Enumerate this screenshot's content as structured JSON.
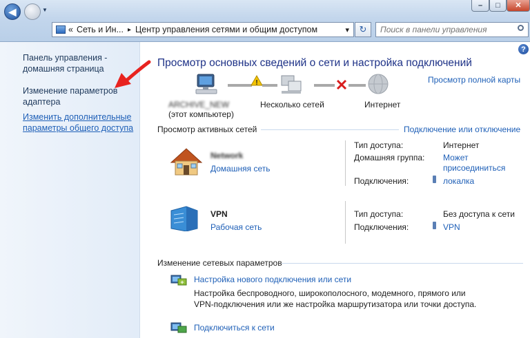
{
  "window": {
    "minimize_glyph": "–",
    "maximize_glyph": "□",
    "close_glyph": "✕"
  },
  "address": {
    "prefix": "«",
    "segment1": "Сеть и Ин...",
    "separator": "▸",
    "segment2": "Центр управления сетями и общим доступом",
    "dropdown": "▾",
    "refresh_glyph": "↻"
  },
  "search": {
    "placeholder": "Поиск в панели управления"
  },
  "sidebar": {
    "items": [
      {
        "label": "Панель управления - домашняя страница"
      },
      {
        "label": "Изменение параметров адаптера"
      },
      {
        "label": "Изменить дополнительные параметры общего доступа"
      }
    ]
  },
  "main": {
    "title": "Просмотр основных сведений о сети и настройка подключений",
    "view_full_map": "Просмотр полной карты",
    "map": {
      "computer_name": "ARCHIVE_NEW",
      "computer_sub": "(этот компьютер)",
      "multiple_networks": "Несколько сетей",
      "internet": "Интернет"
    },
    "active_networks_title": "Просмотр активных сетей",
    "connect_disconnect": "Подключение или отключение",
    "networks": [
      {
        "name": "Network",
        "type": "Домашняя сеть",
        "access_label": "Тип доступа:",
        "access_value": "Интернет",
        "homegroup_label": "Домашняя группа:",
        "homegroup_value": "Может присоединиться",
        "connections_label": "Подключения:",
        "connections_value": "локалка"
      },
      {
        "name": "VPN",
        "type": "Рабочая сеть",
        "access_label": "Тип доступа:",
        "access_value": "Без доступа к сети",
        "connections_label": "Подключения:",
        "connections_value": "VPN"
      }
    ],
    "change_settings_title": "Изменение сетевых параметров",
    "tasks": [
      {
        "link": "Настройка нового подключения или сети",
        "description": "Настройка беспроводного, широкополосного, модемного, прямого или VPN-подключения или же настройка маршрутизатора или точки доступа."
      },
      {
        "link": "Подключиться к сети",
        "description": ""
      }
    ]
  },
  "colors": {
    "link": "#1e5fb7",
    "title": "#1e3287",
    "arrow": "#e8231f"
  }
}
